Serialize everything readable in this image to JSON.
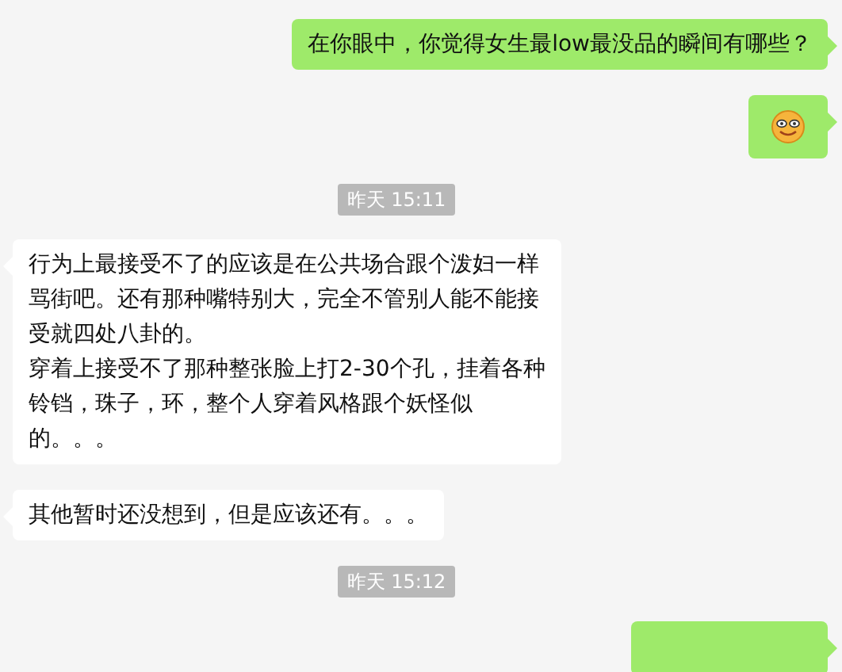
{
  "messages": [
    {
      "kind": "sent_text",
      "paragraphs": [
        "在你眼中，你觉得女生最low最没品的瞬间有哪些？"
      ]
    },
    {
      "kind": "sent_emoji"
    },
    {
      "kind": "time",
      "text": "昨天 15:11"
    },
    {
      "kind": "received_text",
      "paragraphs": [
        "行为上最接受不了的应该是在公共场合跟个泼妇一样骂街吧。还有那种嘴特别大，完全不管别人能不能接受就四处八卦的。",
        "穿着上接受不了那种整张脸上打2-30个孔，挂着各种铃铛，珠子，环，整个人穿着风格跟个妖怪似的。。。"
      ]
    },
    {
      "kind": "received_text",
      "paragraphs": [
        "其他暂时还没想到，但是应该还有。。。"
      ]
    },
    {
      "kind": "time",
      "text": "昨天 15:12"
    },
    {
      "kind": "sent_covered"
    }
  ]
}
